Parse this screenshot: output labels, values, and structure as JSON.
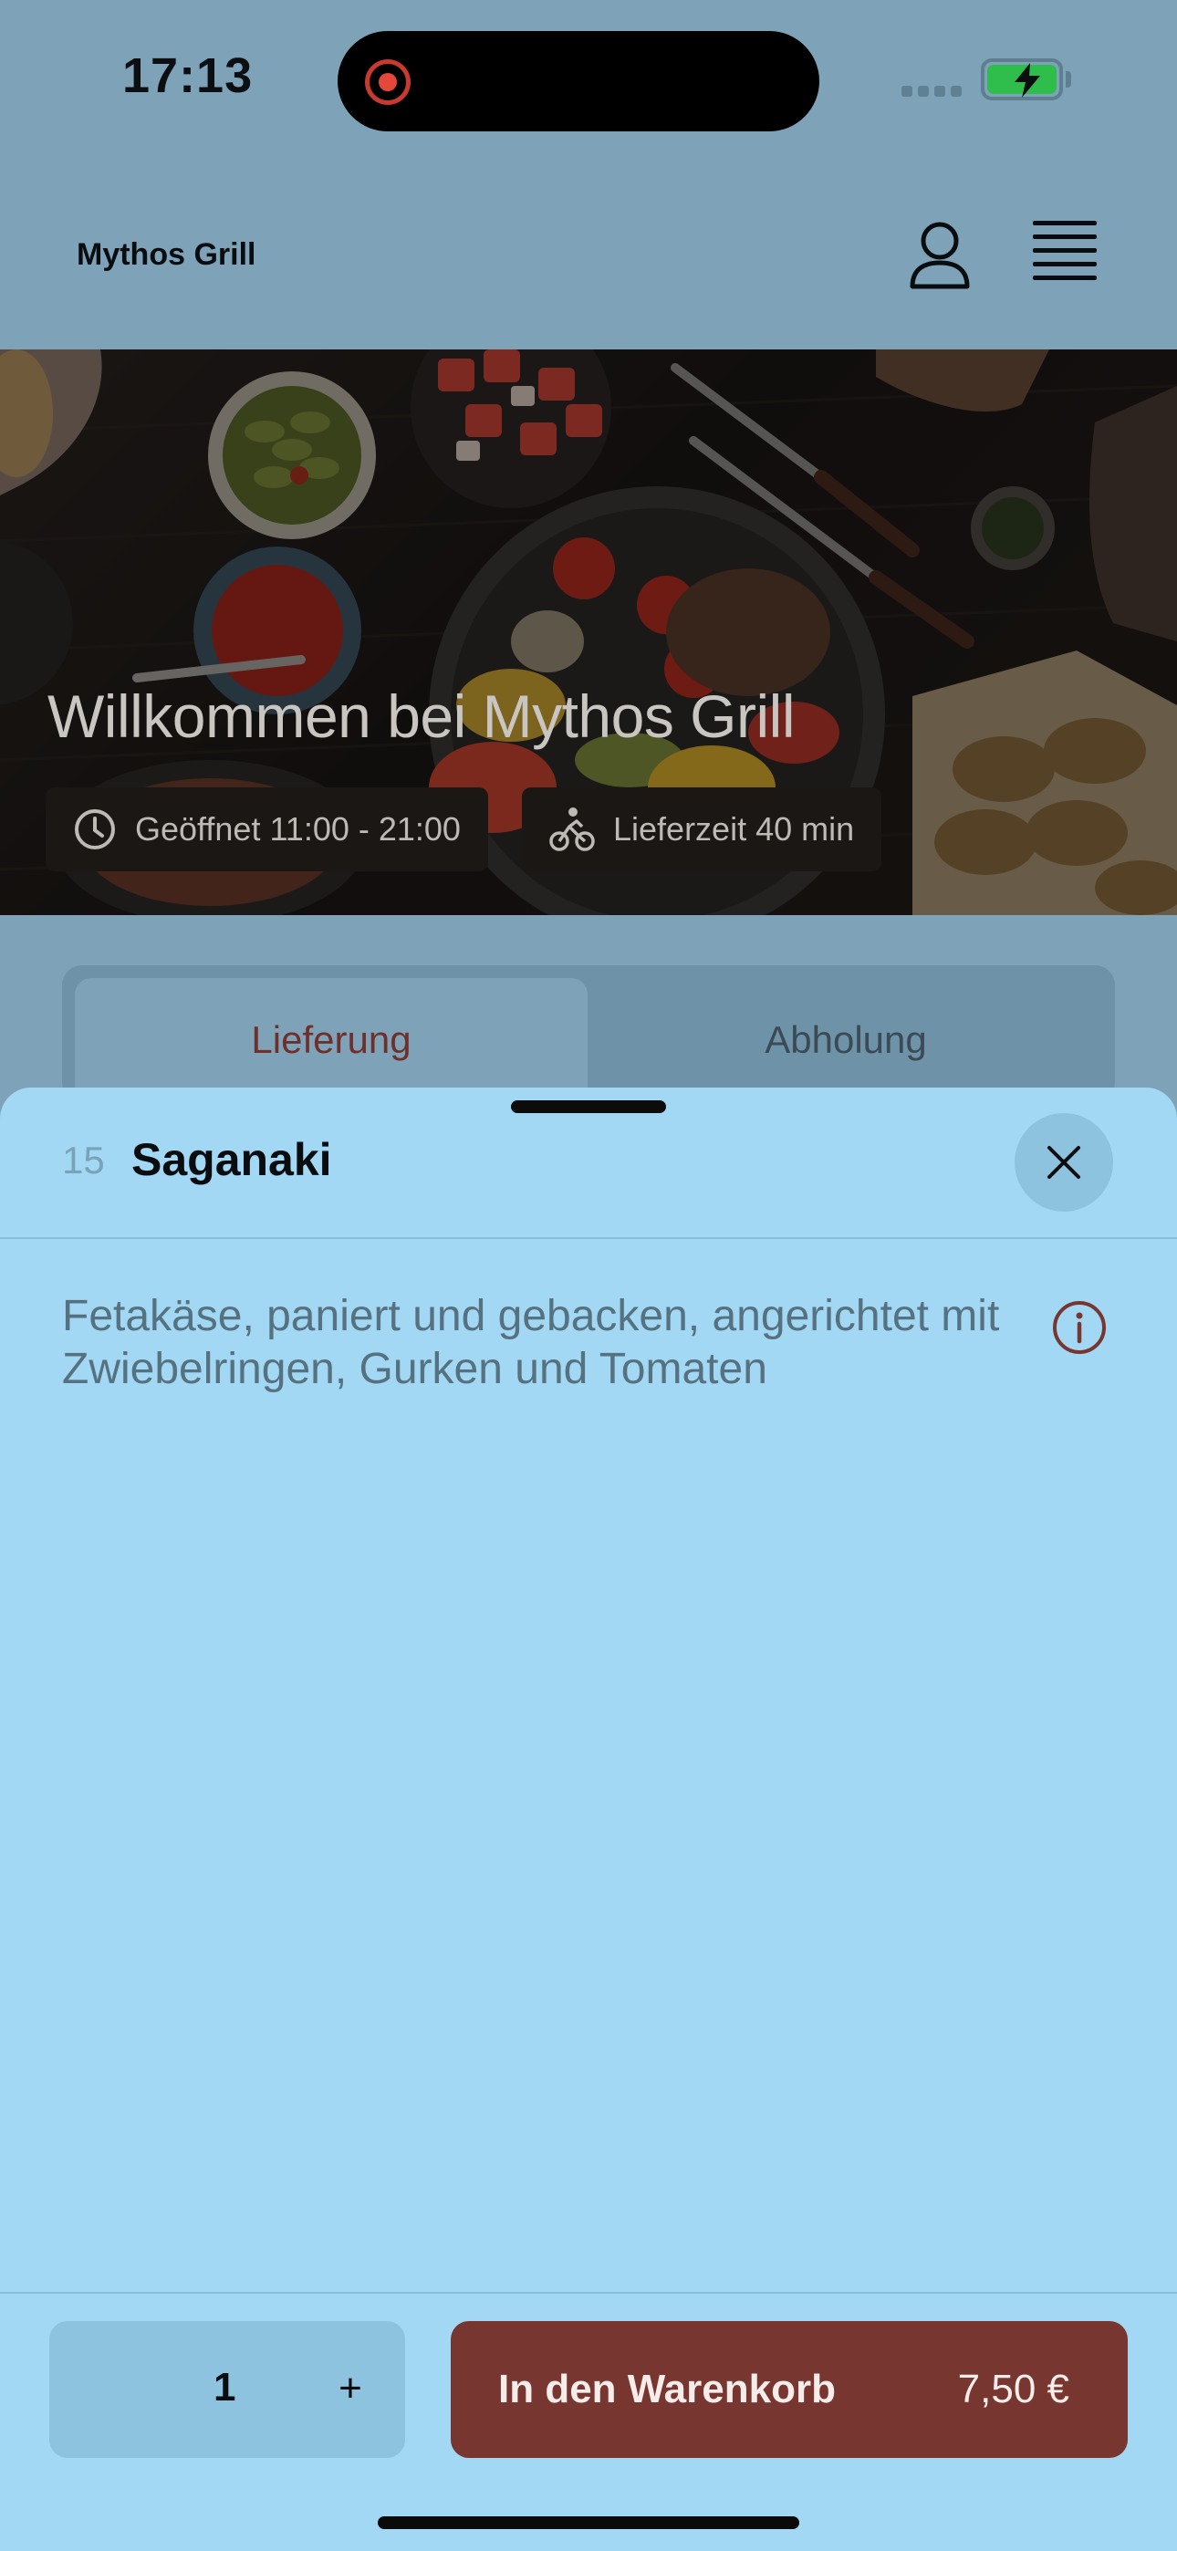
{
  "status_bar": {
    "time": "17:13",
    "recording_icon": "screen-recording-icon",
    "battery_icon": "battery-charging-icon",
    "colors": {
      "recording": "#e5483b",
      "battery": "#2fbd4c"
    }
  },
  "header": {
    "brand": "Mythos Grill",
    "profile_icon": "user-icon",
    "menu_icon": "hamburger-menu-icon"
  },
  "hero": {
    "title": "Willkommen bei Mythos Grill",
    "open_hours": "Geöffnet 11:00 - 21:00",
    "open_icon": "clock-icon",
    "delivery_time": "Lieferzeit 40 min",
    "delivery_icon": "bicycle-courier-icon"
  },
  "mode_tabs": {
    "items": [
      {
        "label": "Lieferung",
        "active": true
      },
      {
        "label": "Abholung",
        "active": false
      }
    ]
  },
  "sheet": {
    "item_number": "15",
    "item_name": "Saganaki",
    "close_icon": "close-icon",
    "description": "Fetakäse, paniert und gebacken, angerichtet mit Zwiebelringen, Gurken und Tomaten",
    "info_icon": "info-icon"
  },
  "footer": {
    "quantity": "1",
    "plus_label": "+",
    "add_to_cart_label": "In den Warenkorb",
    "price": "7,50 €",
    "colors": {
      "accent": "#773630",
      "sheet": "#a2d8f3"
    }
  }
}
